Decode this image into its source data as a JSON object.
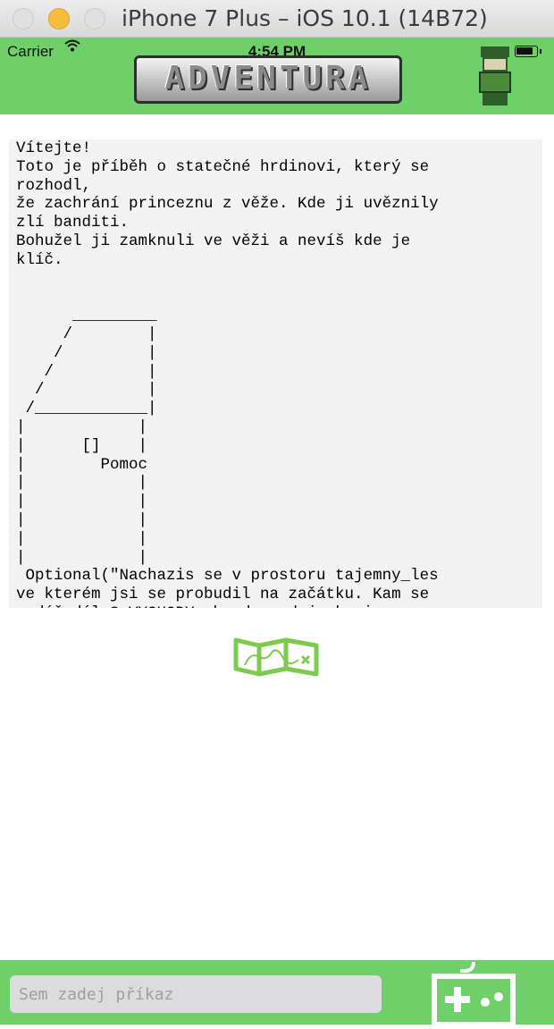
{
  "window": {
    "title": "iPhone 7 Plus – iOS 10.1 (14B72)"
  },
  "status_bar": {
    "carrier": "Carrier",
    "time": "4:54 PM",
    "battery_level": 0.85
  },
  "header": {
    "logo_text": "ADVENTURA"
  },
  "output": {
    "text": "Vítejte!\nToto je příběh o statečné hrdinovi, který se\nrozhodl,\nže zachrání princeznu z věže. Kde ji uvěznily\nzlí banditi.\nBohužel ji zamknuli ve věži a nevíš kde je\nklíč.\n\n\n      _________\n     /        |\n    /         |\n   /          |\n  /           |\n /____________|\n|            |\n|      []    |\n|        Pomoc\n|            |\n|            |\n|            |\n|            |\n|            |\n Optional(\"Nachazis se v prostoru tajemny_les\nve kterém jsi se probudil na začátku. Kam se\nvydáš dál ? VYCHODY: hrad pred_jeskyni"
  },
  "command": {
    "placeholder": "Sem zadej příkaz",
    "value": ""
  },
  "colors": {
    "accent": "#6fd06a",
    "output_bg": "#f2f2f2",
    "input_bg": "#dcdcde"
  },
  "icons": {
    "map": "map-icon",
    "play": "gamepad-icon"
  }
}
